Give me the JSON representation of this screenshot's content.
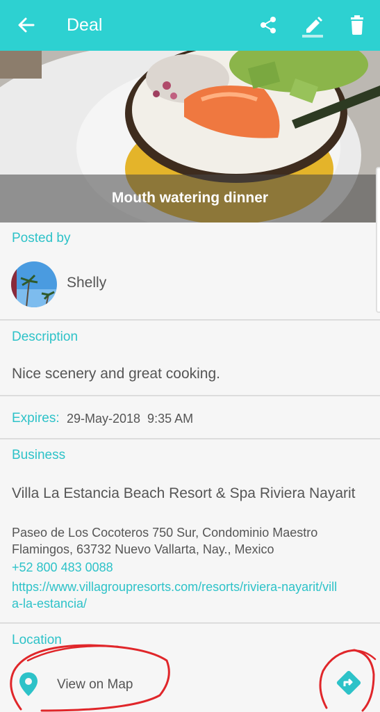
{
  "appbar": {
    "title": "Deal",
    "back_icon": "arrow-back-icon",
    "share_icon": "share-icon",
    "edit_icon": "pencil-icon",
    "delete_icon": "trash-icon",
    "color": "#2dd1d1"
  },
  "hero": {
    "caption": "Mouth watering dinner"
  },
  "posted_by": {
    "label": "Posted by",
    "name": "Shelly"
  },
  "description": {
    "label": "Description",
    "text": "Nice scenery and great cooking."
  },
  "expires": {
    "label": "Expires:",
    "value": "29-May-2018  9:35 AM"
  },
  "business": {
    "label": "Business",
    "name": "Villa La Estancia Beach Resort & Spa Riviera Nayarit",
    "address": "Paseo de Los Cocoteros 750 Sur, Condominio Maestro Flamingos, 63732 Nuevo Vallarta, Nay., Mexico",
    "phone": "+52 800 483 0088",
    "url": "https://www.villagroupresorts.com/resorts/riviera-nayarit/villa-la-estancia/"
  },
  "location": {
    "label": "Location",
    "map_link": "View on Map",
    "pin_icon": "location-pin-icon",
    "directions_icon": "directions-icon"
  },
  "colors": {
    "accent": "#2dc2c8",
    "annotation": "#e0262a"
  }
}
